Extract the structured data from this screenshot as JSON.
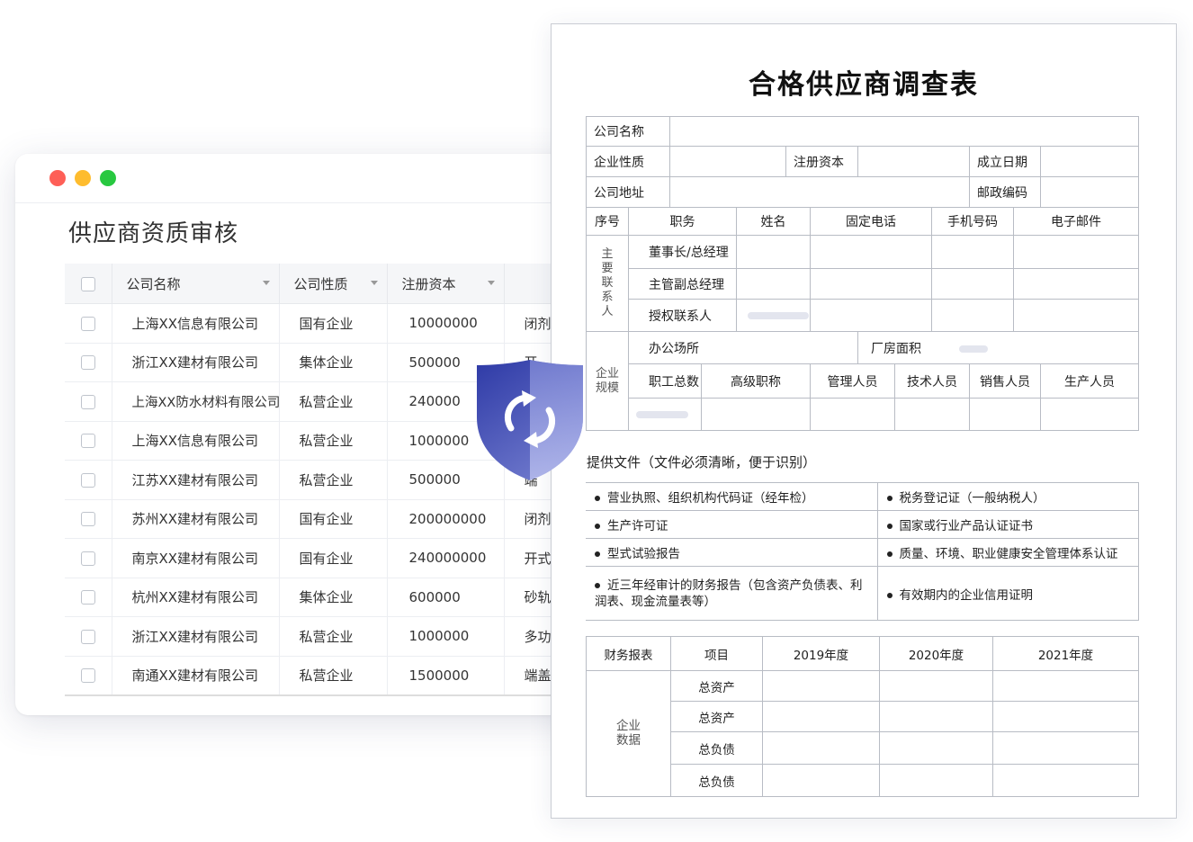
{
  "window": {
    "title": "供应商资质审核",
    "columns": [
      "公司名称",
      "公司性质",
      "注册资本"
    ],
    "rows": [
      {
        "name": "上海XX信息有限公司",
        "type": "国有企业",
        "capital": "10000000",
        "extra": "闭剂"
      },
      {
        "name": "浙江XX建材有限公司",
        "type": "集体企业",
        "capital": "500000",
        "extra": "开"
      },
      {
        "name": "上海XX防水材料有限公司",
        "type": "私营企业",
        "capital": "240000",
        "extra": ""
      },
      {
        "name": "上海XX信息有限公司",
        "type": "私营企业",
        "capital": "1000000",
        "extra": ""
      },
      {
        "name": "江苏XX建材有限公司",
        "type": "私营企业",
        "capital": "500000",
        "extra": "端"
      },
      {
        "name": "苏州XX建材有限公司",
        "type": "国有企业",
        "capital": "200000000",
        "extra": "闭剂"
      },
      {
        "name": "南京XX建材有限公司",
        "type": "国有企业",
        "capital": "240000000",
        "extra": "开式"
      },
      {
        "name": "杭州XX建材有限公司",
        "type": "集体企业",
        "capital": "600000",
        "extra": "砂轨"
      },
      {
        "name": "浙江XX建材有限公司",
        "type": "私营企业",
        "capital": "1000000",
        "extra": "多功"
      },
      {
        "name": "南通XX建材有限公司",
        "type": "私营企业",
        "capital": "1500000",
        "extra": "端盖"
      }
    ]
  },
  "form": {
    "title": "合格供应商调查表",
    "company_name": "公司名称",
    "company_type": "企业性质",
    "reg_capital": "注册资本",
    "founded": "成立日期",
    "address": "公司地址",
    "postcode": "邮政编码",
    "contact_headers": [
      "序号",
      "职务",
      "姓名",
      "固定电话",
      "手机号码",
      "电子邮件"
    ],
    "contact_group": "主要联系人",
    "contact_roles": [
      "董事长/总经理",
      "主管副总经理",
      "授权联系人"
    ],
    "scale_group": "企业规模",
    "office": "办公场所",
    "plant_area": "厂房面积",
    "staff_headers": [
      "职工总数",
      "高级职称",
      "管理人员",
      "技术人员",
      "销售人员",
      "生产人员"
    ],
    "docs_heading": "提供文件（文件必须清晰，便于识别）",
    "docs": [
      [
        "营业执照、组织机构代码证（经年检）",
        "税务登记证（一般纳税人）"
      ],
      [
        "生产许可证",
        "国家或行业产品认证证书"
      ],
      [
        "型式试验报告",
        "质量、环境、职业健康安全管理体系认证"
      ],
      [
        "近三年经审计的财务报告（包含资产负债表、利润表、现金流量表等）",
        "有效期内的企业信用证明"
      ]
    ],
    "fin_headers": [
      "财务报表",
      "项目",
      "2019年度",
      "2020年度",
      "2021年度"
    ],
    "fin_group": "企业数据",
    "fin_items": [
      "总资产",
      "总资产",
      "总负债",
      "总负债"
    ]
  },
  "colors": {
    "shield_top": "#2f3ca8",
    "shield_bottom": "#8a93d8",
    "accent": "#3b46b5"
  }
}
